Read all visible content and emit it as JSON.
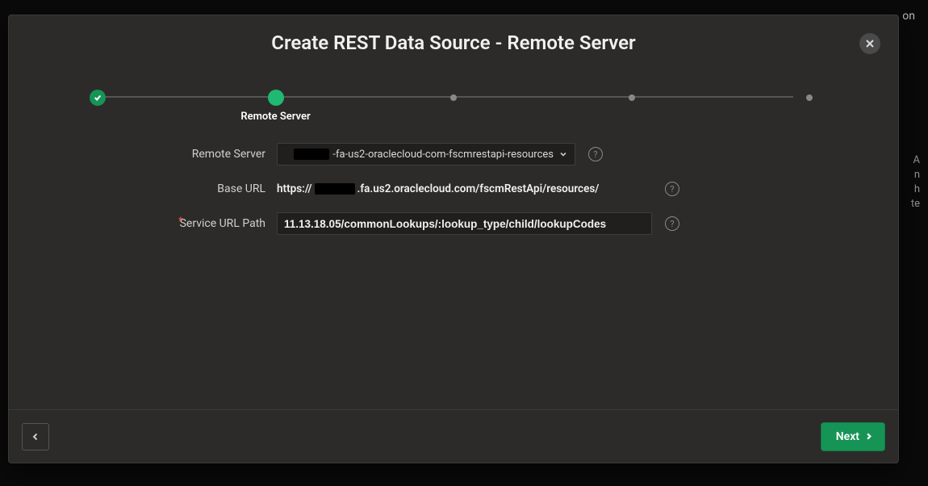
{
  "background": {
    "topright": "on",
    "hint_lines": [
      "A",
      "n",
      "h",
      "te"
    ]
  },
  "dialog": {
    "title": "Create REST Data Source - Remote Server",
    "stepper": {
      "current_label": "Remote Server"
    },
    "form": {
      "remote_server": {
        "label": "Remote Server",
        "value_suffix": "-fa-us2-oraclecloud-com-fscmrestapi-resources"
      },
      "base_url": {
        "label": "Base URL",
        "prefix": "https://",
        "suffix": ".fa.us2.oraclecloud.com/fscmRestApi/resources/"
      },
      "service_url_path": {
        "label": "Service URL Path",
        "value": "11.13.18.05/commonLookups/:lookup_type/child/lookupCodes"
      }
    },
    "footer": {
      "next_label": "Next"
    }
  }
}
